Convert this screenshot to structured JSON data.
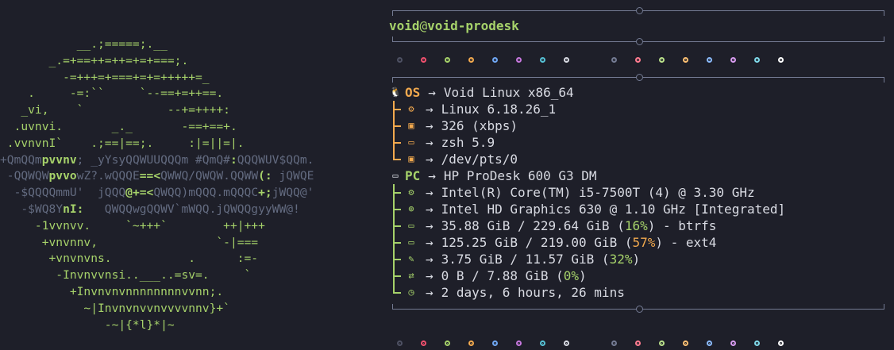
{
  "logo": {
    "lines": [
      [
        {
          "c": "lg",
          "t": "           __.;=====;.__"
        }
      ],
      [
        {
          "c": "lg",
          "t": "       _.=+==++=++=+=+===;."
        }
      ],
      [
        {
          "c": "lg",
          "t": "         -=+++=+===+=+=+++++=_"
        }
      ],
      [
        {
          "c": "lg",
          "t": "    .     -=:``     `--==+=++==."
        }
      ],
      [
        {
          "c": "lg",
          "t": "   _vi,    `            --+=++++:"
        }
      ],
      [
        {
          "c": "lg",
          "t": "  .uvnvi.       _._       -==+==+."
        }
      ],
      [
        {
          "c": "lg",
          "t": " .vvnvnI`    .;==|==;.     :|=||=|."
        }
      ],
      [
        {
          "c": "gr",
          "t": "+QmQQm"
        },
        {
          "c": "lgb",
          "t": "pvvnv"
        },
        {
          "c": "gr",
          "t": "; _yYsyQQWUUQQQm #QmQ#"
        },
        {
          "c": "lgb",
          "t": ":"
        },
        {
          "c": "gr",
          "t": "QQQWUV$QQm."
        }
      ],
      [
        {
          "c": "gr",
          "t": " -QQWQW"
        },
        {
          "c": "lgb",
          "t": "pvvo"
        },
        {
          "c": "gr",
          "t": "wZ?.wQQQE"
        },
        {
          "c": "lgb",
          "t": "==<"
        },
        {
          "c": "gr",
          "t": "QWWQ/QWQW.QQWW"
        },
        {
          "c": "lgb",
          "t": "(:"
        },
        {
          "c": "gr",
          "t": " jQWQE"
        }
      ],
      [
        {
          "c": "gr",
          "t": "  -$QQQQmmU'  jQQQ"
        },
        {
          "c": "lgb",
          "t": "@+=<"
        },
        {
          "c": "gr",
          "t": "QWQQ)mQQQ.mQQQC"
        },
        {
          "c": "lgb",
          "t": "+;"
        },
        {
          "c": "gr",
          "t": "jWQQ@'"
        }
      ],
      [
        {
          "c": "gr",
          "t": "   -$WQ8Y"
        },
        {
          "c": "lgb",
          "t": "nI:"
        },
        {
          "c": "gr",
          "t": "   QWQQwgQQWV`mWQQ.jQWQQgyyWW@!"
        }
      ],
      [
        {
          "c": "lg",
          "t": "     -1vvnvv.     `~+++`        ++|+++"
        }
      ],
      [
        {
          "c": "lg",
          "t": "      +vnvnnv,                 `-|==="
        }
      ],
      [
        {
          "c": "lg",
          "t": "       +vnvnvns.           .      :=-"
        }
      ],
      [
        {
          "c": "lg",
          "t": "        -Invnvvnsi..___..=sv=.     `"
        }
      ],
      [
        {
          "c": "lg",
          "t": "          +Invnvnvnnnnnnnnvvnn;."
        }
      ],
      [
        {
          "c": "lg",
          "t": "            ~|Invnvnvvnvvvvnnv}+`"
        }
      ],
      [
        {
          "c": "lg",
          "t": "               -~|{*l}*|~"
        }
      ]
    ]
  },
  "header": {
    "user": "void",
    "at": "@",
    "host": "void-prodesk"
  },
  "palette_dots": [
    "#4e5163",
    "#f0506e",
    "#a6d26a",
    "#f2a94e",
    "#6fa6f2",
    "#c678dd",
    "#56c2d6",
    "#d9dbe3"
  ],
  "palette_dots_bright": [
    "#747b93",
    "#ff7b8f",
    "#b9e08a",
    "#ffc073",
    "#8cbcff",
    "#d89cf0",
    "#7fd8e8",
    "#ffffff"
  ],
  "arrow": "→",
  "os": {
    "key": "OS",
    "icon": "tux-icon",
    "value": "Void Linux x86_64",
    "rows": [
      {
        "name": "kernel",
        "icon": "gear-icon",
        "value": "Linux 6.18.26_1"
      },
      {
        "name": "packages",
        "icon": "package-icon",
        "value": "326 (xbps)"
      },
      {
        "name": "shell",
        "icon": "terminal-icon",
        "value": "zsh 5.9"
      },
      {
        "name": "terminal",
        "icon": "terminal-window-icon",
        "value": "/dev/pts/0"
      }
    ]
  },
  "pc": {
    "key": "PC",
    "icon": "desktop-icon",
    "value": "HP ProDesk 600 G3 DM",
    "rows": [
      {
        "name": "cpu",
        "icon": "cpu-icon",
        "value": "Intel(R) Core(TM) i5-7500T (4) @ 3.30 GHz"
      },
      {
        "name": "gpu",
        "icon": "gpu-icon",
        "value": "Intel HD Graphics 630 @ 1.10 GHz [Integrated]"
      },
      {
        "name": "disk-root",
        "icon": "disk-icon",
        "pre": "35.88 GiB / 229.64 GiB (",
        "pct": "16%",
        "post": ") - btrfs",
        "pct_color": "green"
      },
      {
        "name": "disk-home",
        "icon": "disk-icon",
        "pre": "125.25 GiB / 219.00 GiB (",
        "pct": "57%",
        "post": ") - ext4",
        "pct_color": "orange"
      },
      {
        "name": "memory",
        "icon": "memory-icon",
        "pre": "3.75 GiB / 11.57 GiB (",
        "pct": "32%",
        "post": ")",
        "pct_color": "green"
      },
      {
        "name": "swap",
        "icon": "swap-icon",
        "pre": "0 B / 7.88 GiB (",
        "pct": "0%",
        "post": ")",
        "pct_color": "green"
      },
      {
        "name": "uptime",
        "icon": "clock-icon",
        "value": "2 days, 6 hours, 26 mins"
      }
    ]
  }
}
